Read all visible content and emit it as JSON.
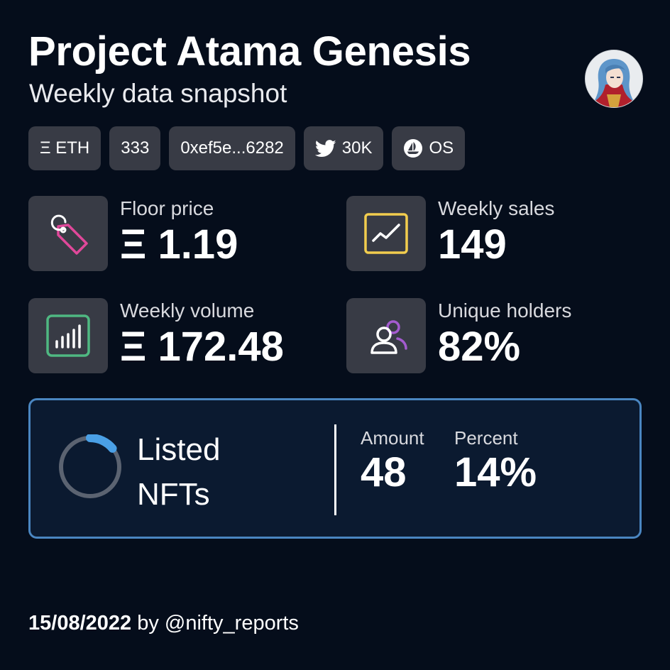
{
  "header": {
    "title": "Project Atama Genesis",
    "subtitle": "Weekly data snapshot"
  },
  "chips": [
    {
      "label": "Ξ ETH",
      "icon": ""
    },
    {
      "label": "333",
      "icon": ""
    },
    {
      "label": "0xef5e...6282",
      "icon": ""
    },
    {
      "label": "30K",
      "icon": "twitter-icon"
    },
    {
      "label": "OS",
      "icon": "opensea-icon"
    }
  ],
  "stats": {
    "floor": {
      "label": "Floor price",
      "value": "Ξ 1.19",
      "icon": "price-tag-icon",
      "color": "#e0489a"
    },
    "sales": {
      "label": "Weekly sales",
      "value": "149",
      "icon": "trend-chart-icon",
      "color": "#f2cd4e"
    },
    "volume": {
      "label": "Weekly volume",
      "value": "Ξ 172.48",
      "icon": "bar-chart-icon",
      "color": "#4fb882"
    },
    "holders": {
      "label": "Unique holders",
      "value": "82%",
      "icon": "users-icon",
      "color": "#a45bd0"
    }
  },
  "listed": {
    "title_line1": "Listed",
    "title_line2": "NFTs",
    "amount_label": "Amount",
    "amount_value": "48",
    "percent_label": "Percent",
    "percent_value": "14%",
    "ring_fraction": 0.14,
    "accent": "#4aa0e6",
    "border": "#4a86c1"
  },
  "footer": {
    "date": "15/08/2022",
    "by": "by @nifty_reports"
  }
}
